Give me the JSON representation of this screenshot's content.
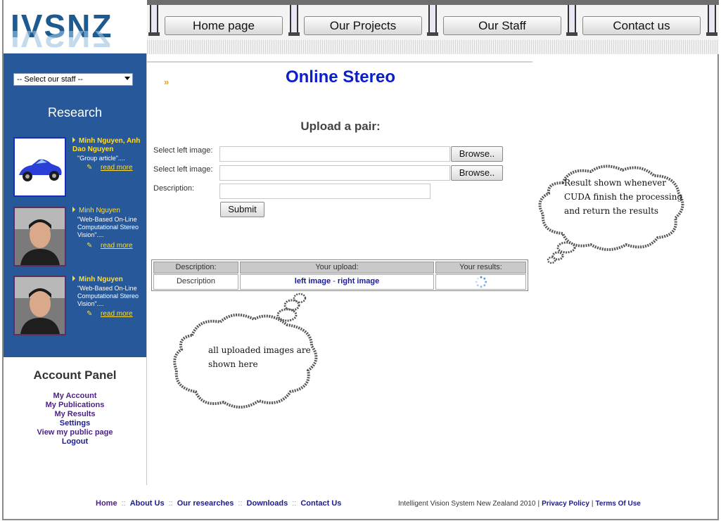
{
  "brand": {
    "logo_text": "IVSNZ"
  },
  "nav": {
    "items": [
      "Home page",
      "Our Projects",
      "Our Staff",
      "Contact us"
    ]
  },
  "sidebar": {
    "staff_select": "-- Select our staff --",
    "research_title": "Research",
    "research_items": [
      {
        "author": "Minh Nguyen, Anh Dao Nguyen",
        "desc": "\"Group article\"....",
        "more": "read more"
      },
      {
        "author": "Minh Nguyen",
        "desc": "\"Web-Based On-Line Computational Stereo Vision\"....",
        "more": "read more"
      },
      {
        "author": "Minh Nguyen",
        "desc": "\"Web-Based On-Line Computational Stereo Vision\"....",
        "more": "read more"
      }
    ],
    "account_title": "Account Panel",
    "account_links": [
      "My Account",
      "My Publications",
      "My Results",
      "Settings",
      "View my public page",
      "Logout"
    ]
  },
  "main": {
    "title": "Online Stereo",
    "upload_title": "Upload a pair:",
    "form": {
      "left_label": "Select left image:",
      "right_label": "Select left image:",
      "desc_label": "Description:",
      "browse_label": "Browse..",
      "submit_label": "Submit"
    },
    "table": {
      "headers": [
        "Description:",
        "Your upload:",
        "Your results:"
      ],
      "row": {
        "description": "Description",
        "left_link": "left image",
        "separator": " - ",
        "right_link": "right image"
      }
    },
    "bubbles": {
      "results_note": [
        "Result shown whenever",
        "CUDA finish the processing",
        "and return the  results"
      ],
      "uploads_note": [
        "all uploaded images are",
        "shown here"
      ]
    }
  },
  "footer": {
    "links": [
      "Home",
      "About Us",
      "Our researches",
      "Downloads",
      "Contact Us"
    ],
    "separator": "::",
    "copyright": "Intelligent Vision System New Zealand 2010",
    "privacy": "Privacy Policy",
    "terms": "Terms Of Use"
  },
  "colors": {
    "sidebar_blue": "#27599a",
    "title_blue": "#0a1ecc",
    "accent_yellow": "#ffdd33",
    "link_purple": "#4b1f86"
  }
}
